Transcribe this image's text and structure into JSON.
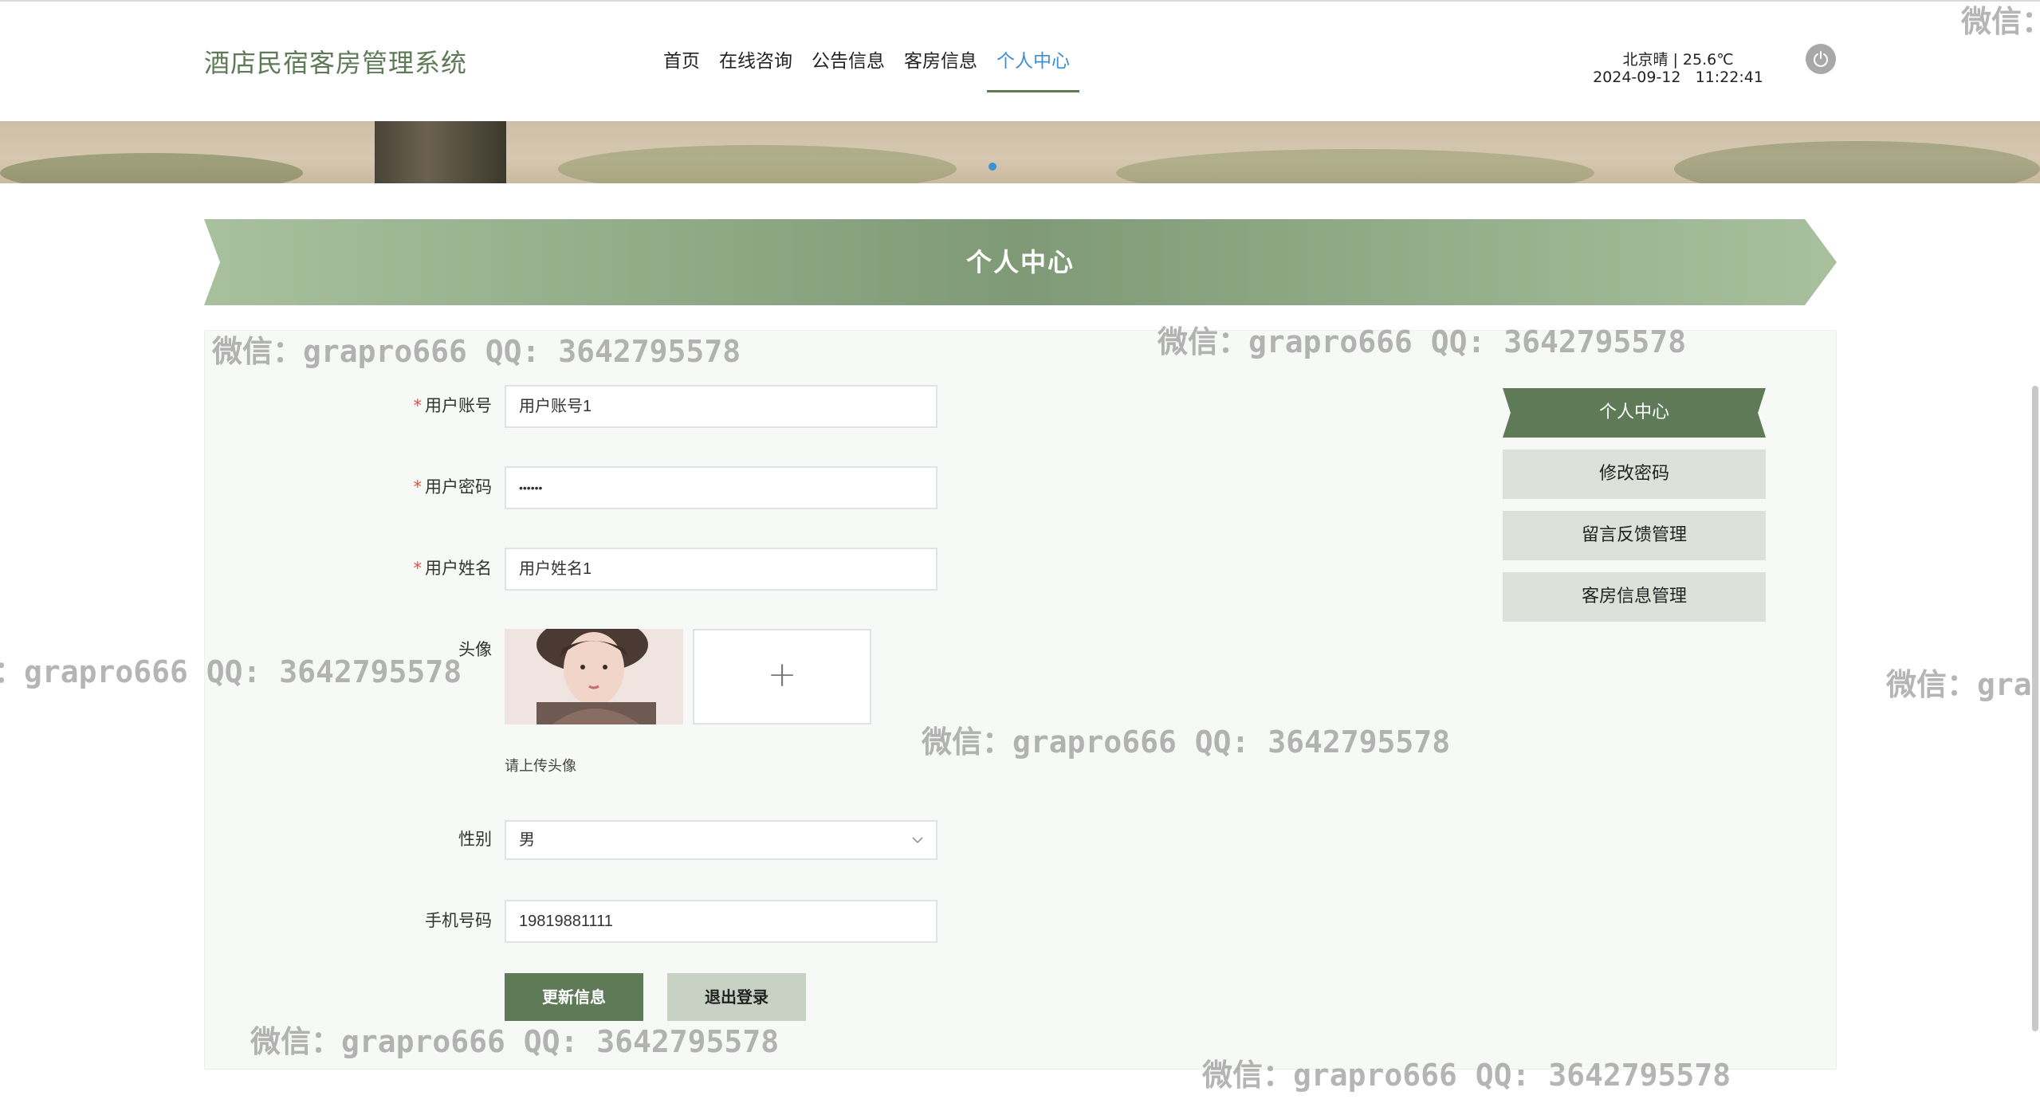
{
  "app": {
    "title": "酒店民宿客房管理系统"
  },
  "nav": {
    "items": [
      {
        "label": "首页"
      },
      {
        "label": "在线咨询"
      },
      {
        "label": "公告信息"
      },
      {
        "label": "客房信息"
      },
      {
        "label": "个人中心"
      }
    ],
    "active_index": 4
  },
  "weather": {
    "line1": "北京晴 | 25.6℃",
    "line2": "2024-09-12   11:22:41"
  },
  "banner": {
    "slide_count": 1,
    "active_slide": 0
  },
  "page": {
    "title": "个人中心"
  },
  "form": {
    "account": {
      "label": "用户账号",
      "value": "用户账号1",
      "required": true
    },
    "password": {
      "label": "用户密码",
      "value": "••••••",
      "required": true
    },
    "name": {
      "label": "用户姓名",
      "value": "用户姓名1",
      "required": true
    },
    "avatar": {
      "label": "头像",
      "upload_icon": "plus-icon",
      "hint": "请上传头像"
    },
    "gender": {
      "label": "性别",
      "value": "男"
    },
    "phone": {
      "label": "手机号码",
      "value": "19819881111"
    },
    "submit_label": "更新信息",
    "logout_label": "退出登录"
  },
  "side_menu": {
    "items": [
      {
        "label": "个人中心"
      },
      {
        "label": "修改密码"
      },
      {
        "label": "留言反馈管理"
      },
      {
        "label": "客房信息管理"
      }
    ],
    "active_index": 0
  },
  "watermark": {
    "text": "微信：grapro666 QQ: 3642795578",
    "partial_right": "微信：gra",
    "partial_top": "微信：",
    "partial_left": "：grapro666 QQ: 3642795578"
  },
  "colors": {
    "accent": "#5e7a57",
    "nav_active": "#3d8fd6",
    "required": "#e74c3c",
    "side_inactive": "#dce1da"
  }
}
